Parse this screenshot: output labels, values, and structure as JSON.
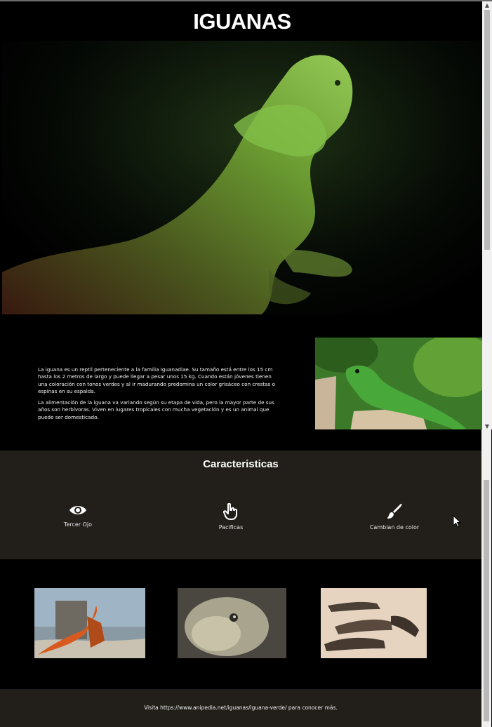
{
  "header": {
    "title": "IGUANAS"
  },
  "intro": {
    "paragraphs": [
      "La iguana es un reptil perteneciente a la familia Iguanadiae. Su tamaño está entre los 15 cm hasta los 2 metros de largo y puede llegar a pesar unos 15 kg. Cuando están jóvenes tienen una coloración con tonos verdes y al ir madurando predomina un color grisáceo con crestas o espinas en su espalda.",
      "La alimentación de la iguana va variando según su etapa de vida, pero la mayor parte de sus años son herbívoras. Viven en lugares tropicales con mucha vegetación y es un animal que puede ser domesticado."
    ]
  },
  "features": {
    "title": "Caracteristicas",
    "items": [
      {
        "label": "Tercer Ojo",
        "icon": "eye-icon"
      },
      {
        "label": "Pacificas",
        "icon": "hand-pointer-icon"
      },
      {
        "label": "Cambian de color",
        "icon": "paintbrush-icon"
      }
    ]
  },
  "footer": {
    "text": "Visita https://www.anipedia.net/iguanas/iguana-verde/ para conocer más."
  },
  "colors": {
    "page_bg": "#000000",
    "section_bg": "#221f1b",
    "scrollbar_track": "#f1f1f1",
    "scrollbar_thumb": "#b9b9b9"
  }
}
